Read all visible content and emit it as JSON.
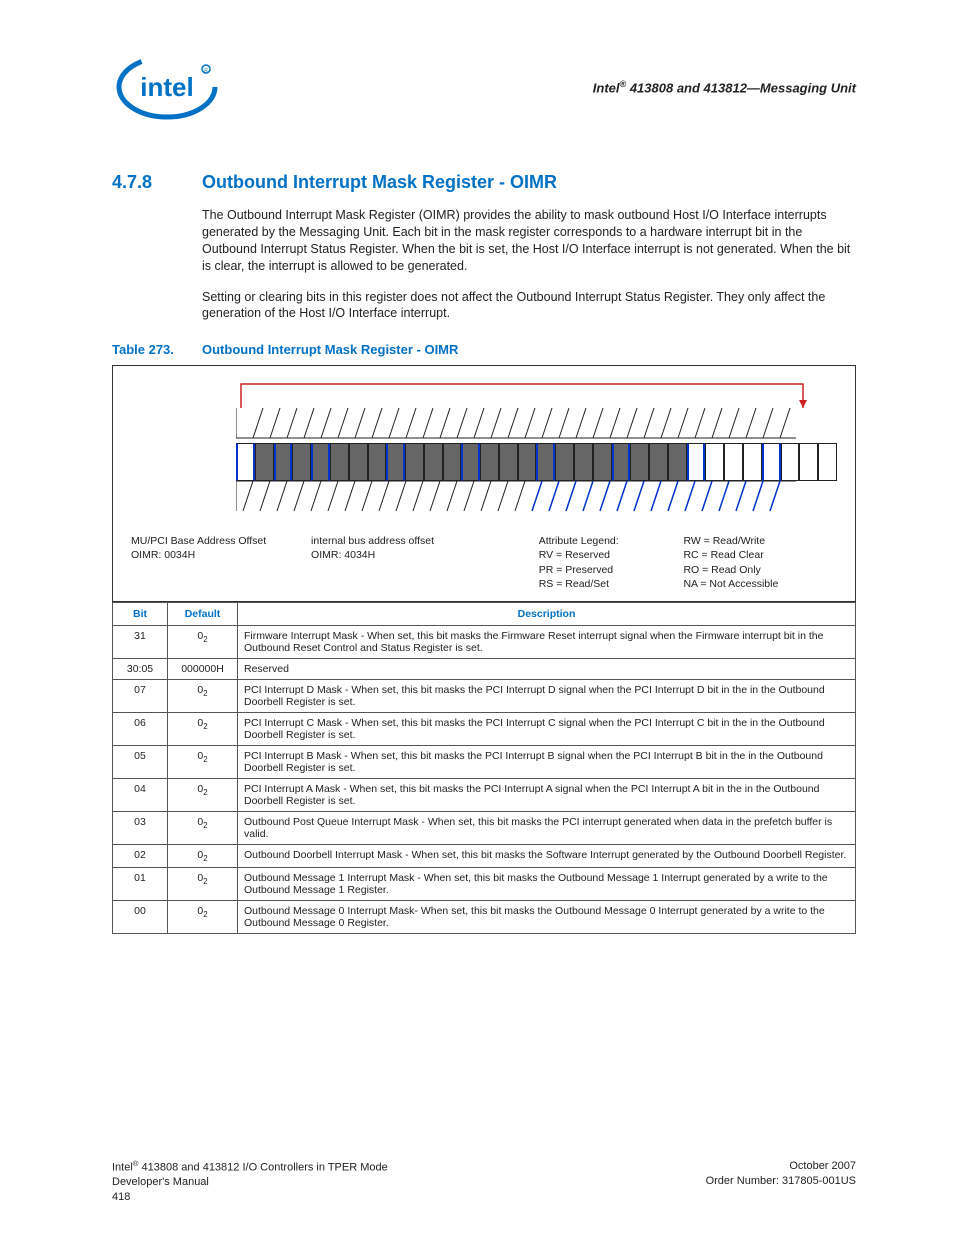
{
  "header": {
    "text_prefix": "Intel",
    "reg_mark": "®",
    "text_suffix": " 413808 and 413812—Messaging Unit"
  },
  "section": {
    "number": "4.7.8",
    "title": "Outbound Interrupt Mask Register - OIMR"
  },
  "para1": "The Outbound Interrupt Mask Register (OIMR) provides the ability to mask outbound Host I/O Interface interrupts generated by the Messaging Unit. Each bit in the mask register corresponds to a hardware interrupt bit in the Outbound Interrupt Status Register. When the bit is set, the Host I/O Interface interrupt is not generated. When the bit is clear, the interrupt is allowed to be generated.",
  "para2": "Setting or clearing bits in this register does not affect the Outbound Interrupt Status Register. They only affect the generation of the Host I/O Interface interrupt.",
  "table_caption": {
    "num": "Table 273.",
    "title": "Outbound Interrupt Mask Register - OIMR"
  },
  "offsets": {
    "mupci_label": "MU/PCI Base Address Offset",
    "mupci_value": "OIMR: 0034H",
    "internal_label": "internal bus address offset",
    "internal_value": "OIMR: 4034H"
  },
  "legend": {
    "title": "Attribute Legend:",
    "rv": "RV = Reserved",
    "pr": "PR = Preserved",
    "rs": "RS = Read/Set",
    "rw": "RW = Read/Write",
    "rc": "RC = Read Clear",
    "ro": "RO = Read Only",
    "na": "NA = Not Accessible"
  },
  "table_headers": {
    "bit": "Bit",
    "default": "Default",
    "desc": "Description"
  },
  "rows": [
    {
      "bit": "31",
      "def": "0",
      "sub": "2",
      "desc": "Firmware Interrupt Mask - When set, this bit masks the Firmware Reset interrupt signal when the Firmware interrupt bit in the Outbound Reset Control and Status Register is set."
    },
    {
      "bit": "30:05",
      "def": "000000H",
      "sub": "",
      "desc": "Reserved"
    },
    {
      "bit": "07",
      "def": "0",
      "sub": "2",
      "desc": "PCI Interrupt D Mask - When set, this bit masks the PCI Interrupt D signal when the PCI Interrupt D bit in the in the Outbound Doorbell Register is set."
    },
    {
      "bit": "06",
      "def": "0",
      "sub": "2",
      "desc": "PCI Interrupt C Mask - When set, this bit masks the PCI Interrupt C signal when the PCI Interrupt C bit in the in the Outbound Doorbell Register is set."
    },
    {
      "bit": "05",
      "def": "0",
      "sub": "2",
      "desc": "PCI Interrupt B Mask - When set, this bit masks the PCI Interrupt B signal when the PCI Interrupt B bit in the in the Outbound Doorbell Register is set."
    },
    {
      "bit": "04",
      "def": "0",
      "sub": "2",
      "desc": "PCI Interrupt A Mask - When set, this bit masks the PCI Interrupt A signal when the PCI Interrupt A bit in the in the Outbound Doorbell Register is set."
    },
    {
      "bit": "03",
      "def": "0",
      "sub": "2",
      "desc": "Outbound Post Queue Interrupt Mask - When set, this bit masks the PCI interrupt generated when data in the prefetch buffer is valid."
    },
    {
      "bit": "02",
      "def": "0",
      "sub": "2",
      "desc": "Outbound Doorbell Interrupt Mask - When set, this bit masks the Software Interrupt generated by the Outbound Doorbell Register."
    },
    {
      "bit": "01",
      "def": "0",
      "sub": "2",
      "desc": "Outbound Message 1 Interrupt Mask - When set, this bit masks the Outbound Message 1 Interrupt generated by a write to the Outbound Message 1 Register."
    },
    {
      "bit": "00",
      "def": "0",
      "sub": "2",
      "desc": "Outbound Message 0 Interrupt Mask- When set, this bit masks the Outbound Message 0 Interrupt generated by a write to the Outbound Message 0 Register."
    }
  ],
  "footer": {
    "left1_prefix": "Intel",
    "left1_reg": "®",
    "left1_suffix": " 413808 and 413812 I/O Controllers in TPER Mode",
    "left2": "Developer's Manual",
    "left3": "418",
    "right1": "October 2007",
    "right2": "Order Number: 317805-001US"
  }
}
